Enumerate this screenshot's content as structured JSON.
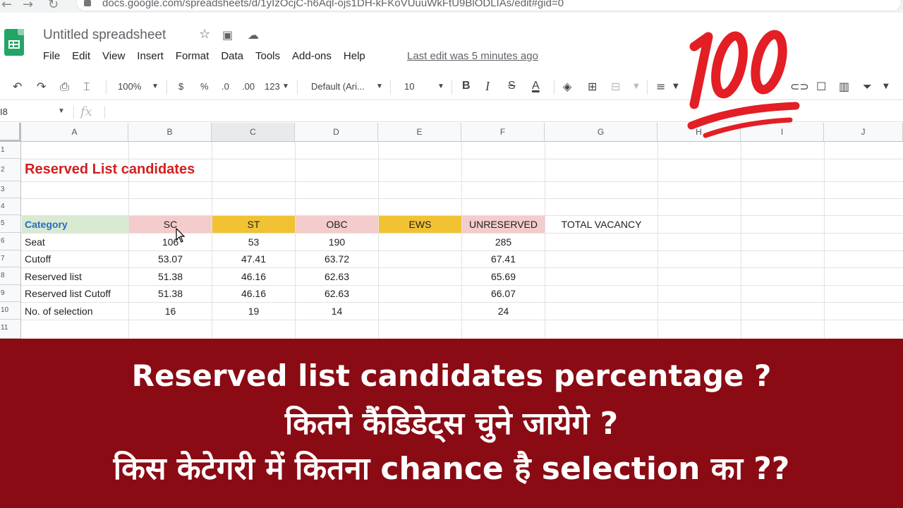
{
  "browser": {
    "url": "docs.google.com/spreadsheets/d/1yIzOcjC-h6Aql-ojs1DH-kFKoVUuuWkFtU9BlODLIAs/edit#gid=0"
  },
  "doc": {
    "title": "Untitled spreadsheet",
    "menu": [
      "File",
      "Edit",
      "View",
      "Insert",
      "Format",
      "Data",
      "Tools",
      "Add-ons",
      "Help"
    ],
    "last_edit": "Last edit was 5 minutes ago"
  },
  "toolbar": {
    "zoom": "100%",
    "currency": "$",
    "percent": "%",
    "dec_decrease": ".0",
    "dec_increase": ".00",
    "format_more": "123",
    "font": "Default (Ari...",
    "font_size": "10",
    "bold": "B",
    "italic": "I",
    "strike": "S",
    "text_color": "A"
  },
  "formula_bar": {
    "name_box": "I8",
    "fx": "fx"
  },
  "grid": {
    "columns": [
      "A",
      "B",
      "C",
      "D",
      "E",
      "F",
      "G",
      "H",
      "I",
      "J"
    ],
    "rows": [
      "1",
      "2",
      "3",
      "4",
      "5",
      "6",
      "7",
      "8",
      "9",
      "10",
      "11"
    ],
    "title": "Reserved List candidates",
    "headers": {
      "category": "Category",
      "sc": "SC",
      "st": "ST",
      "obc": "OBC",
      "ews": "EWS",
      "unreserved": "UNRESERVED",
      "total": "TOTAL VACANCY"
    },
    "data_rows": [
      {
        "label": "Seat",
        "sc": "106",
        "st": "53",
        "obc": "190",
        "ews": "",
        "ur": "285"
      },
      {
        "label": "Cutoff",
        "sc": "53.07",
        "st": "47.41",
        "obc": "63.72",
        "ews": "",
        "ur": "67.41"
      },
      {
        "label": "Reserved list",
        "sc": "51.38",
        "st": "46.16",
        "obc": "62.63",
        "ews": "",
        "ur": "65.69"
      },
      {
        "label": "Reserved list Cutoff",
        "sc": "51.38",
        "st": "46.16",
        "obc": "62.63",
        "ews": "",
        "ur": "66.07"
      },
      {
        "label": "No. of selection",
        "sc": "16",
        "st": "19",
        "obc": "14",
        "ews": "",
        "ur": "24"
      }
    ]
  },
  "overlay": {
    "emoji": "100"
  },
  "banner": {
    "line1": "Reserved list candidates percentage ?",
    "line2": "कितने कैंडिडेट्स चुने जायेगे ?",
    "line3": "किस केटेगरी में कितना chance है selection का ??"
  },
  "colors": {
    "sc_fill": "#f4cccc",
    "st_fill": "#f1c232",
    "obc_fill": "#f4cccc",
    "ews_fill": "#f1c232",
    "category_fill": "#d9ead3",
    "title_color": "#d21f1f",
    "banner_bg": "#8a0b14"
  }
}
